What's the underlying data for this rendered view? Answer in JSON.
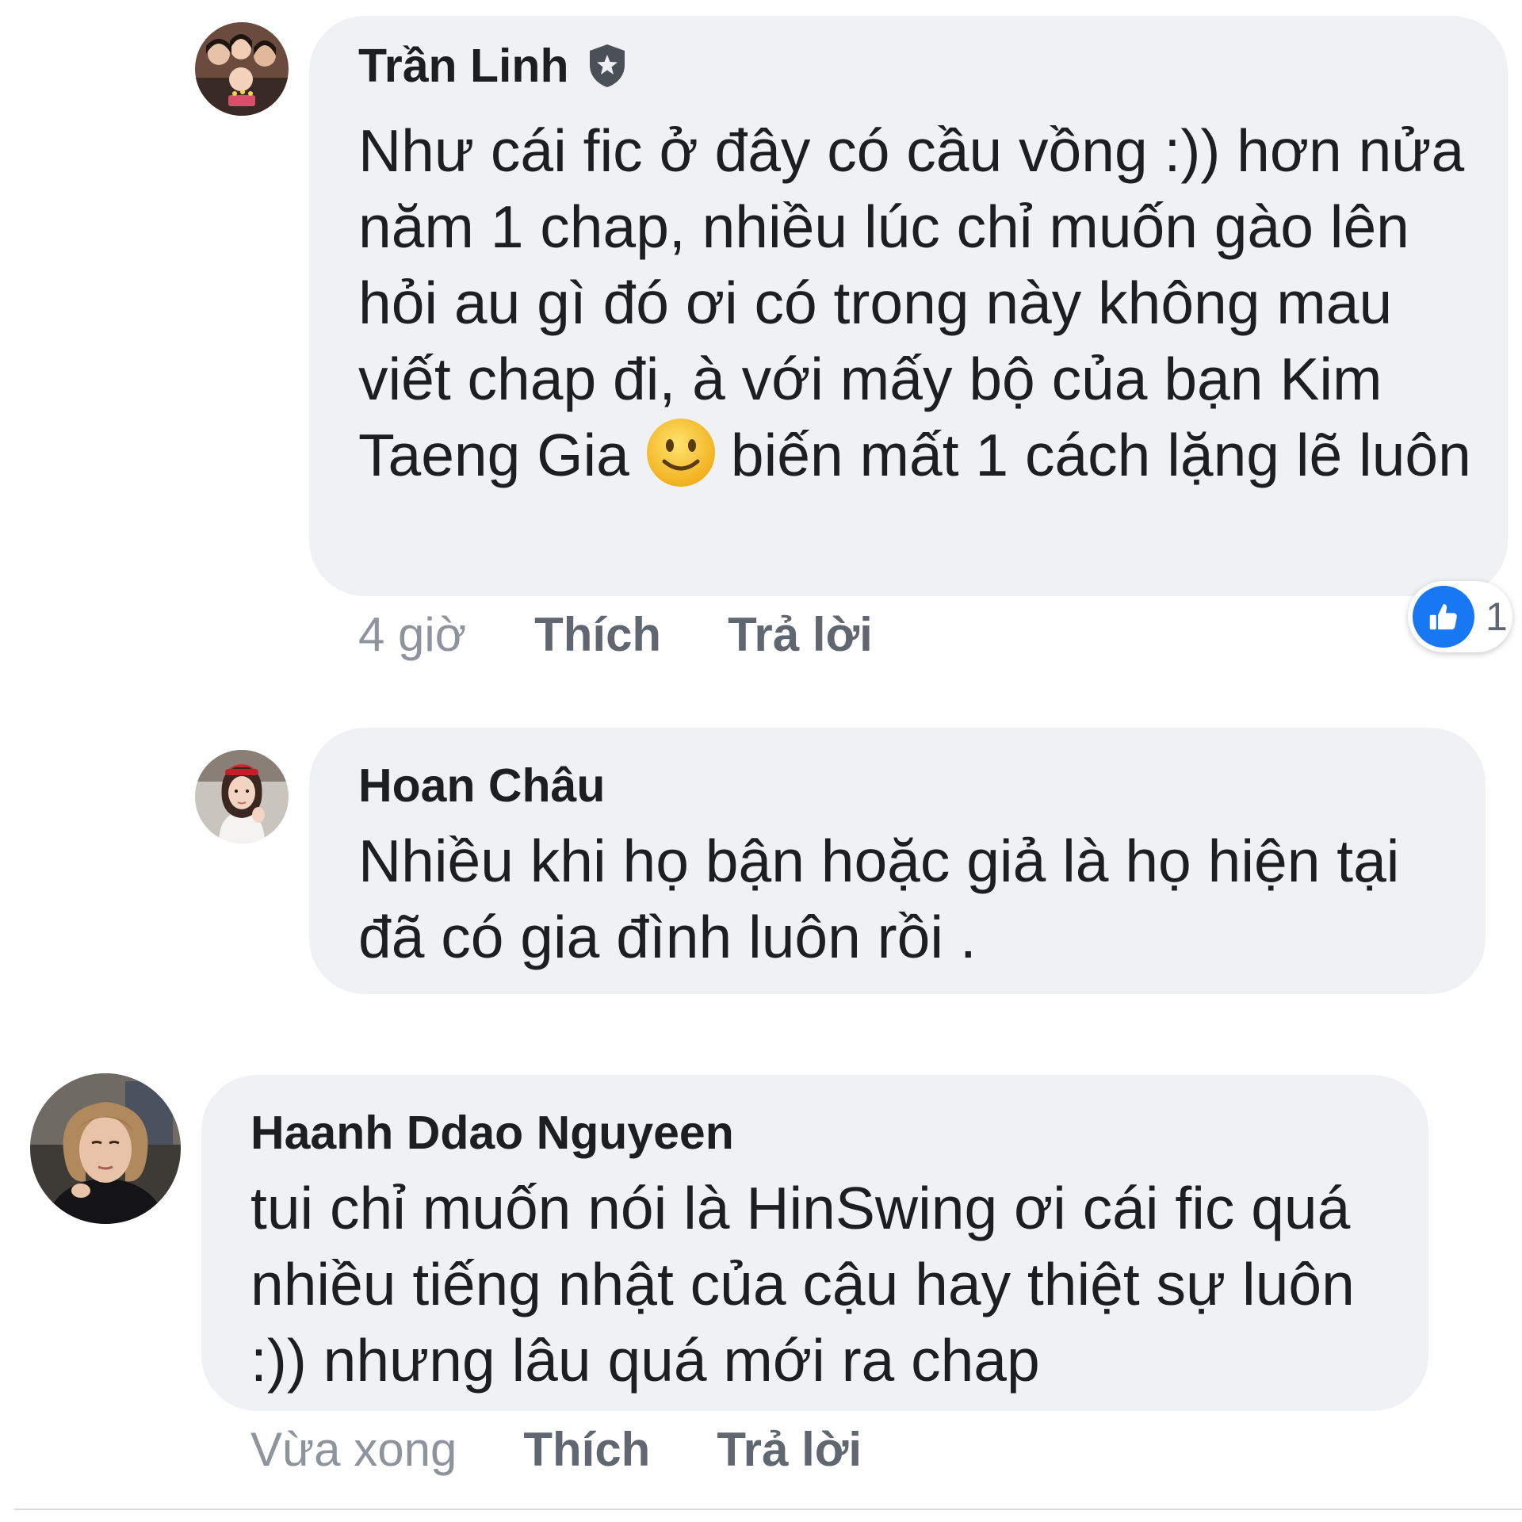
{
  "comments": [
    {
      "author": "Trần Linh",
      "badge_icon": "top-fan-badge-icon",
      "text_parts": [
        "Như cái fic ở đây có cầu vồng :)) hơn nửa năm 1 chap, nhiều lúc chỉ muốn gào lên hỏi au gì đó ơi có trong này không mau viết chap đi, à với mấy bộ của bạn Kim Taeng Gia",
        "biến mất 1 cách lặng lẽ luôn"
      ],
      "emoji": "slightly-smiling-face-emoji",
      "time": "4 giờ",
      "like_label": "Thích",
      "reply_label": "Trả lời",
      "reaction": {
        "icon": "like-icon",
        "count": "1",
        "color": "#1877f2"
      }
    },
    {
      "author": "Hoan Châu",
      "text": "Nhiều khi họ bận hoặc giả là họ hiện tại đã có gia đình luôn rồi ."
    },
    {
      "author": "Haanh Ddao Nguyeen",
      "text": "tui chỉ muốn nói là HinSwing ơi cái fic quá nhiều tiếng nhật của cậu hay thiệt sự luôn :)) nhưng lâu quá mới ra chap",
      "time": "Vừa xong",
      "like_label": "Thích",
      "reply_label": "Trả lời"
    }
  ],
  "colors": {
    "bubble": "#f0f1f4",
    "text": "#1c1e21",
    "muted": "#8d949e",
    "action": "#606770",
    "accent": "#1877f2"
  }
}
